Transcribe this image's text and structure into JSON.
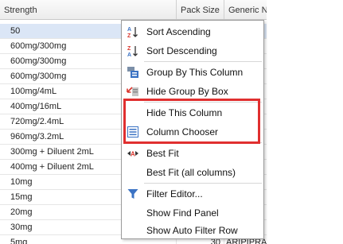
{
  "grid": {
    "headers": [
      "Strength",
      "Pack Size",
      "Generic Na"
    ],
    "rows": [
      {
        "strength": "50",
        "pack": "",
        "generic": ""
      },
      {
        "strength": "600mg/300mg",
        "pack": "",
        "generic": ""
      },
      {
        "strength": "600mg/300mg",
        "pack": "",
        "generic": ""
      },
      {
        "strength": "600mg/300mg",
        "pack": "",
        "generic": ""
      },
      {
        "strength": "100mg/4mL",
        "pack": "",
        "generic": ""
      },
      {
        "strength": "400mg/16mL",
        "pack": "",
        "generic": ""
      },
      {
        "strength": "720mg/2.4mL",
        "pack": "",
        "generic": ""
      },
      {
        "strength": "960mg/3.2mL",
        "pack": "",
        "generic": ""
      },
      {
        "strength": "300mg + Diluent 2mL",
        "pack": "",
        "generic": ""
      },
      {
        "strength": "400mg + Diluent 2mL",
        "pack": "",
        "generic": ""
      },
      {
        "strength": "10mg",
        "pack": "",
        "generic": ""
      },
      {
        "strength": "15mg",
        "pack": "",
        "generic": ""
      },
      {
        "strength": "20mg",
        "pack": "",
        "generic": ""
      },
      {
        "strength": "30mg",
        "pack": "",
        "generic": ""
      },
      {
        "strength": "5mg",
        "pack": "30",
        "generic": "ARIPIPRA"
      }
    ]
  },
  "context_menu": {
    "items": [
      {
        "label": "Sort Ascending",
        "icon": "sort-ascending-icon"
      },
      {
        "label": "Sort Descending",
        "icon": "sort-descending-icon"
      },
      {
        "label": "Group By This Column",
        "icon": "group-by-icon"
      },
      {
        "label": "Hide Group By Box",
        "icon": "hide-group-box-icon"
      },
      {
        "label": "Hide This Column",
        "icon": ""
      },
      {
        "label": "Column Chooser",
        "icon": "column-chooser-icon"
      },
      {
        "label": "Best Fit",
        "icon": "best-fit-icon"
      },
      {
        "label": "Best Fit (all columns)",
        "icon": ""
      },
      {
        "label": "Filter Editor...",
        "icon": "filter-icon"
      },
      {
        "label": "Show Find Panel",
        "icon": ""
      },
      {
        "label": "Show Auto Filter Row",
        "icon": ""
      }
    ]
  },
  "colors": {
    "highlight_box": "#e02f2f",
    "selected_row": "#dbe6f6",
    "icon_blue": "#3b73c4",
    "icon_red": "#d9342b"
  }
}
